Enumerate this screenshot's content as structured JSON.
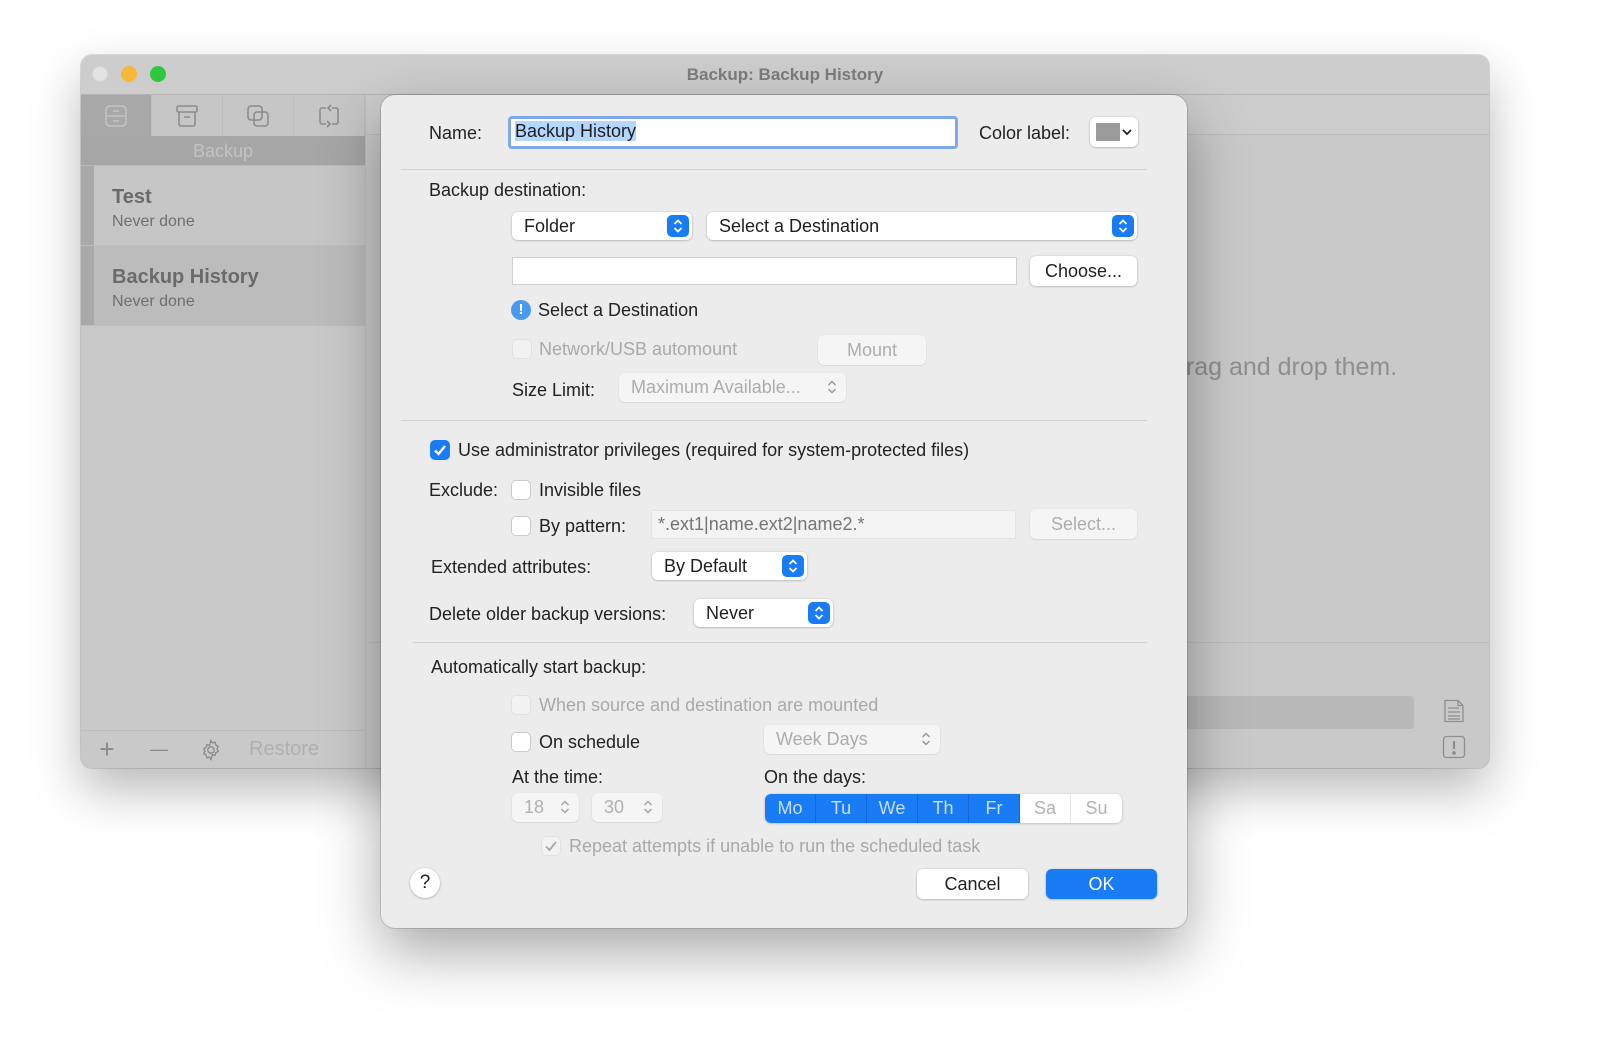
{
  "window": {
    "title": "Backup: Backup History",
    "sidebar": {
      "tabs": [
        {
          "icon": "cabinet-icon",
          "active": true
        },
        {
          "icon": "archive-box-icon",
          "active": false
        },
        {
          "icon": "copy-icon",
          "active": false
        },
        {
          "icon": "sync-icon",
          "active": false
        }
      ],
      "section_title": "Backup",
      "items": [
        {
          "name": "Test",
          "status": "Never done",
          "selected": false
        },
        {
          "name": "Backup History",
          "status": "Never done",
          "selected": true
        }
      ],
      "footer": {
        "add_label": "+",
        "remove_label": "—",
        "settings_icon": "gear-icon",
        "restore_label": "Restore"
      }
    },
    "main": {
      "hint_text": "drag and drop them.",
      "log_icon": "document-icon",
      "alert_icon": "exclamation-box-icon"
    }
  },
  "dialog": {
    "name_label": "Name:",
    "name_value": "Backup History",
    "color_label": "Color label:",
    "color_value": "#9b9b9b",
    "destination": {
      "label": "Backup destination:",
      "type_value": "Folder",
      "target_value": "Select a Destination",
      "path_value": "",
      "choose_label": "Choose...",
      "warning_text": "Select a Destination",
      "automount_label": "Network/USB automount",
      "automount_checked": false,
      "mount_label": "Mount",
      "size_limit_label": "Size Limit:",
      "size_limit_value": "Maximum Available..."
    },
    "admin_label": "Use administrator privileges (required for system-protected files)",
    "admin_checked": true,
    "exclude": {
      "label": "Exclude:",
      "invisible_label": "Invisible files",
      "invisible_checked": false,
      "pattern_label": "By pattern:",
      "pattern_checked": false,
      "pattern_placeholder": "*.ext1|name.ext2|name2.*",
      "select_label": "Select..."
    },
    "extended_attributes": {
      "label": "Extended attributes:",
      "value": "By Default"
    },
    "delete_older": {
      "label": "Delete older backup versions:",
      "value": "Never"
    },
    "auto_start": {
      "label": "Automatically start backup:",
      "when_mounted_label": "When source and destination are mounted",
      "when_mounted_checked": false,
      "on_schedule_label": "On schedule",
      "on_schedule_checked": false,
      "frequency_value": "Week Days",
      "time_label": "At the time:",
      "hour_value": "18",
      "minute_value": "30",
      "days_label": "On the days:",
      "days": [
        {
          "label": "Mo",
          "on": true
        },
        {
          "label": "Tu",
          "on": true
        },
        {
          "label": "We",
          "on": true
        },
        {
          "label": "Th",
          "on": true
        },
        {
          "label": "Fr",
          "on": true
        },
        {
          "label": "Sa",
          "on": false
        },
        {
          "label": "Su",
          "on": false
        }
      ],
      "repeat_label": "Repeat attempts if unable to run the scheduled task",
      "repeat_checked": true
    },
    "help_label": "?",
    "cancel_label": "Cancel",
    "ok_label": "OK"
  },
  "colors": {
    "accent": "#1a7cf5",
    "focus_ring": "#7fa8ee",
    "info": "#4a99f0"
  }
}
